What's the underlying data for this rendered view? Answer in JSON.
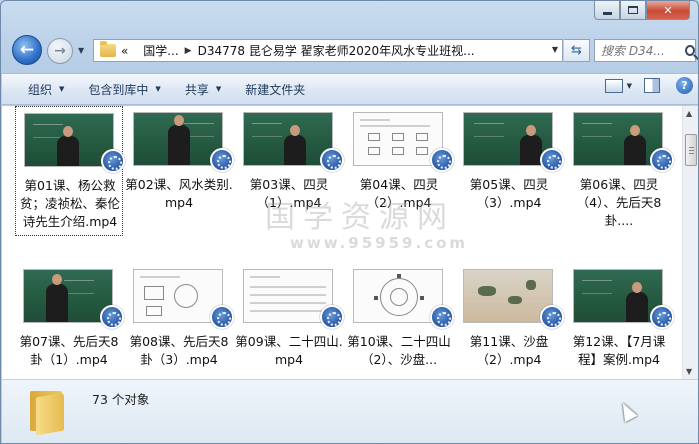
{
  "window": {
    "caption": {
      "minimize": "minimize",
      "maximize": "maximize",
      "close": "✕"
    }
  },
  "nav": {
    "back_icon": "arrow-left-icon",
    "forward_icon": "arrow-right-icon",
    "breadcrumb": {
      "overflow": "«",
      "parent": "国学...",
      "current": "D34778 昆仑易学 翟家老师2020年风水专业班视..."
    },
    "search": {
      "placeholder": "搜索 D34..."
    }
  },
  "toolbar": {
    "organize": "组织",
    "include_in_library": "包含到库中",
    "share": "共享",
    "new_folder": "新建文件夹"
  },
  "files": [
    {
      "name": "第01课、杨公救贫；凌祯松、秦伦诗先生介绍.mp4",
      "thumb": "board",
      "selected": true
    },
    {
      "name": "第02课、风水类别.mp4",
      "thumb": "board2"
    },
    {
      "name": "第03课、四灵（1）.mp4",
      "thumb": "board"
    },
    {
      "name": "第04课、四灵（2）.mp4",
      "thumb": "paper"
    },
    {
      "name": "第05课、四灵（3）.mp4",
      "thumb": "board"
    },
    {
      "name": "第06课、四灵（4）、先后天8卦....",
      "thumb": "board"
    },
    {
      "name": "第07课、先后天8卦（1）.mp4",
      "thumb": "board"
    },
    {
      "name": "第08课、先后天8卦（3）.mp4",
      "thumb": "paper2"
    },
    {
      "name": "第09课、二十四山.mp4",
      "thumb": "paper3"
    },
    {
      "name": "第10课、二十四山（2）、沙盘...",
      "thumb": "paper4"
    },
    {
      "name": "第11课、沙盘（2）.mp4",
      "thumb": "ground"
    },
    {
      "name": "第12课、【7月课程】案例.mp4",
      "thumb": "board"
    }
  ],
  "watermark": {
    "text": "国学资源网",
    "url": "www.95959.com"
  },
  "details": {
    "count": "73 个对象"
  },
  "colors": {
    "accent": "#2f6fc7",
    "board": "#2f6a52",
    "close": "#c74a36"
  }
}
